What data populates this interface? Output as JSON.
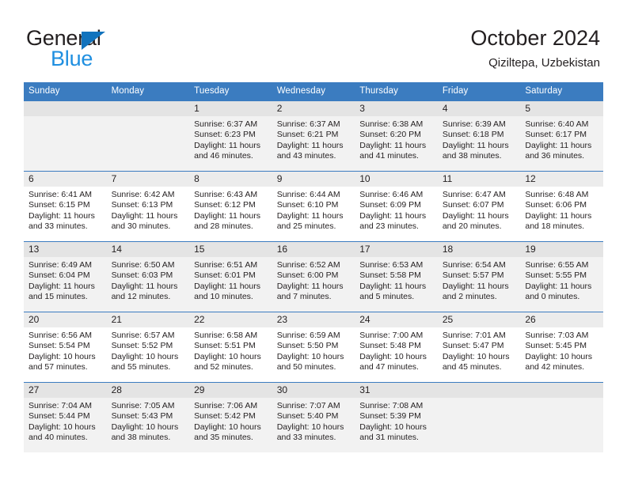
{
  "brand": {
    "name_part1": "General",
    "name_part2": "Blue",
    "logo_icon": "triangle-logo-icon",
    "color_dark": "#231f20",
    "color_blue": "#1f8fe0",
    "triangle_color": "#1173bd"
  },
  "header": {
    "title": "October 2024",
    "subtitle": "Qiziltepa, Uzbekistan"
  },
  "theme": {
    "header_row_bg": "#3b7cc0",
    "header_row_text": "#ffffff",
    "daynum_bg": "#ececec",
    "row_shaded_bg": "#f2f2f2",
    "cell_text": "#231f20"
  },
  "weekdays": [
    "Sunday",
    "Monday",
    "Tuesday",
    "Wednesday",
    "Thursday",
    "Friday",
    "Saturday"
  ],
  "weeks": [
    {
      "shaded": true,
      "days": [
        {
          "num": "",
          "info": ""
        },
        {
          "num": "",
          "info": ""
        },
        {
          "num": "1",
          "info": "Sunrise: 6:37 AM\nSunset: 6:23 PM\nDaylight: 11 hours\nand 46 minutes."
        },
        {
          "num": "2",
          "info": "Sunrise: 6:37 AM\nSunset: 6:21 PM\nDaylight: 11 hours\nand 43 minutes."
        },
        {
          "num": "3",
          "info": "Sunrise: 6:38 AM\nSunset: 6:20 PM\nDaylight: 11 hours\nand 41 minutes."
        },
        {
          "num": "4",
          "info": "Sunrise: 6:39 AM\nSunset: 6:18 PM\nDaylight: 11 hours\nand 38 minutes."
        },
        {
          "num": "5",
          "info": "Sunrise: 6:40 AM\nSunset: 6:17 PM\nDaylight: 11 hours\nand 36 minutes."
        }
      ]
    },
    {
      "shaded": false,
      "days": [
        {
          "num": "6",
          "info": "Sunrise: 6:41 AM\nSunset: 6:15 PM\nDaylight: 11 hours\nand 33 minutes."
        },
        {
          "num": "7",
          "info": "Sunrise: 6:42 AM\nSunset: 6:13 PM\nDaylight: 11 hours\nand 30 minutes."
        },
        {
          "num": "8",
          "info": "Sunrise: 6:43 AM\nSunset: 6:12 PM\nDaylight: 11 hours\nand 28 minutes."
        },
        {
          "num": "9",
          "info": "Sunrise: 6:44 AM\nSunset: 6:10 PM\nDaylight: 11 hours\nand 25 minutes."
        },
        {
          "num": "10",
          "info": "Sunrise: 6:46 AM\nSunset: 6:09 PM\nDaylight: 11 hours\nand 23 minutes."
        },
        {
          "num": "11",
          "info": "Sunrise: 6:47 AM\nSunset: 6:07 PM\nDaylight: 11 hours\nand 20 minutes."
        },
        {
          "num": "12",
          "info": "Sunrise: 6:48 AM\nSunset: 6:06 PM\nDaylight: 11 hours\nand 18 minutes."
        }
      ]
    },
    {
      "shaded": true,
      "days": [
        {
          "num": "13",
          "info": "Sunrise: 6:49 AM\nSunset: 6:04 PM\nDaylight: 11 hours\nand 15 minutes."
        },
        {
          "num": "14",
          "info": "Sunrise: 6:50 AM\nSunset: 6:03 PM\nDaylight: 11 hours\nand 12 minutes."
        },
        {
          "num": "15",
          "info": "Sunrise: 6:51 AM\nSunset: 6:01 PM\nDaylight: 11 hours\nand 10 minutes."
        },
        {
          "num": "16",
          "info": "Sunrise: 6:52 AM\nSunset: 6:00 PM\nDaylight: 11 hours\nand 7 minutes."
        },
        {
          "num": "17",
          "info": "Sunrise: 6:53 AM\nSunset: 5:58 PM\nDaylight: 11 hours\nand 5 minutes."
        },
        {
          "num": "18",
          "info": "Sunrise: 6:54 AM\nSunset: 5:57 PM\nDaylight: 11 hours\nand 2 minutes."
        },
        {
          "num": "19",
          "info": "Sunrise: 6:55 AM\nSunset: 5:55 PM\nDaylight: 11 hours\nand 0 minutes."
        }
      ]
    },
    {
      "shaded": false,
      "days": [
        {
          "num": "20",
          "info": "Sunrise: 6:56 AM\nSunset: 5:54 PM\nDaylight: 10 hours\nand 57 minutes."
        },
        {
          "num": "21",
          "info": "Sunrise: 6:57 AM\nSunset: 5:52 PM\nDaylight: 10 hours\nand 55 minutes."
        },
        {
          "num": "22",
          "info": "Sunrise: 6:58 AM\nSunset: 5:51 PM\nDaylight: 10 hours\nand 52 minutes."
        },
        {
          "num": "23",
          "info": "Sunrise: 6:59 AM\nSunset: 5:50 PM\nDaylight: 10 hours\nand 50 minutes."
        },
        {
          "num": "24",
          "info": "Sunrise: 7:00 AM\nSunset: 5:48 PM\nDaylight: 10 hours\nand 47 minutes."
        },
        {
          "num": "25",
          "info": "Sunrise: 7:01 AM\nSunset: 5:47 PM\nDaylight: 10 hours\nand 45 minutes."
        },
        {
          "num": "26",
          "info": "Sunrise: 7:03 AM\nSunset: 5:45 PM\nDaylight: 10 hours\nand 42 minutes."
        }
      ]
    },
    {
      "shaded": true,
      "days": [
        {
          "num": "27",
          "info": "Sunrise: 7:04 AM\nSunset: 5:44 PM\nDaylight: 10 hours\nand 40 minutes."
        },
        {
          "num": "28",
          "info": "Sunrise: 7:05 AM\nSunset: 5:43 PM\nDaylight: 10 hours\nand 38 minutes."
        },
        {
          "num": "29",
          "info": "Sunrise: 7:06 AM\nSunset: 5:42 PM\nDaylight: 10 hours\nand 35 minutes."
        },
        {
          "num": "30",
          "info": "Sunrise: 7:07 AM\nSunset: 5:40 PM\nDaylight: 10 hours\nand 33 minutes."
        },
        {
          "num": "31",
          "info": "Sunrise: 7:08 AM\nSunset: 5:39 PM\nDaylight: 10 hours\nand 31 minutes."
        },
        {
          "num": "",
          "info": ""
        },
        {
          "num": "",
          "info": ""
        }
      ]
    }
  ]
}
